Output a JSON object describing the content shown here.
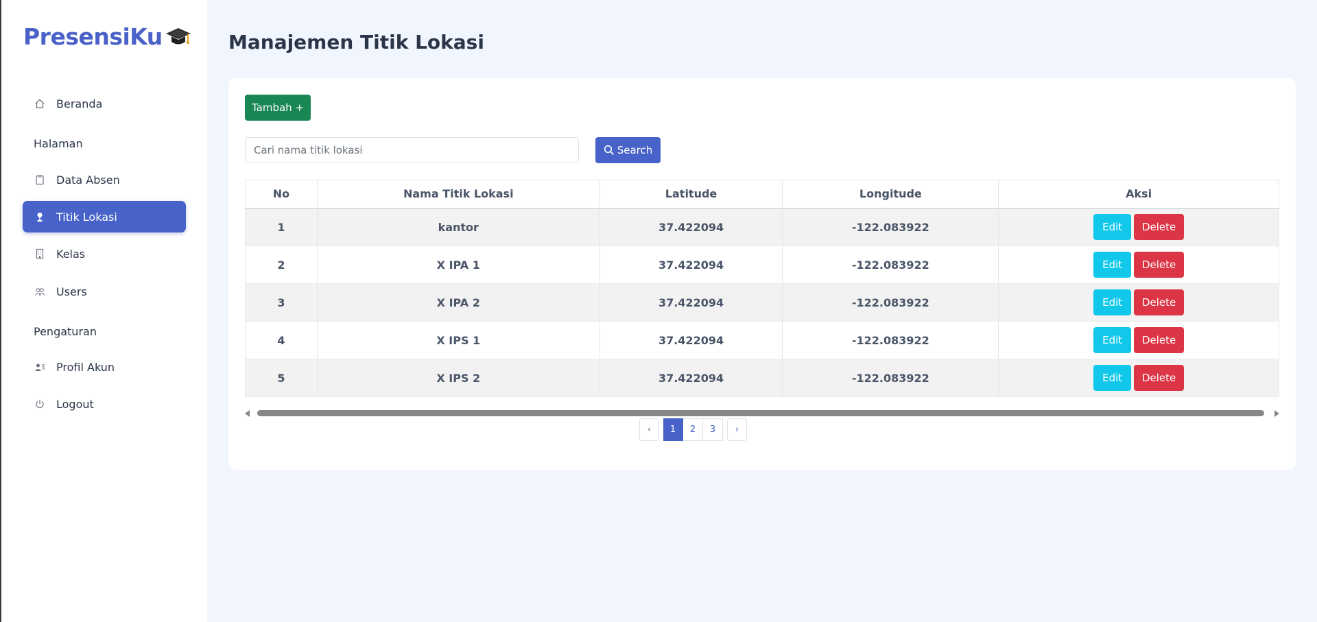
{
  "brand": {
    "name": "PresensiKu",
    "icon": "graduation-cap-icon"
  },
  "sidebar": {
    "items": [
      {
        "label": "Beranda",
        "icon": "home-icon"
      },
      {
        "label": "Data Absen",
        "icon": "clipboard-icon"
      },
      {
        "label": "Titik Lokasi",
        "icon": "map-pin-icon",
        "active": true
      },
      {
        "label": "Kelas",
        "icon": "building-icon"
      },
      {
        "label": "Users",
        "icon": "users-icon"
      },
      {
        "label": "Profil Akun",
        "icon": "user-card-icon"
      },
      {
        "label": "Logout",
        "icon": "power-icon"
      }
    ],
    "sections": [
      "Halaman",
      "Pengaturan"
    ]
  },
  "page": {
    "title": "Manajemen Titik Lokasi"
  },
  "toolbar": {
    "add_label": "Tambah +",
    "search_placeholder": "Cari nama titik lokasi",
    "search_label": "Search"
  },
  "table": {
    "headers": [
      "No",
      "Nama Titik Lokasi",
      "Latitude",
      "Longitude",
      "Aksi"
    ],
    "rows": [
      {
        "no": "1",
        "name": "kantor",
        "lat": "37.422094",
        "lng": "-122.083922"
      },
      {
        "no": "2",
        "name": "X IPA 1",
        "lat": "37.422094",
        "lng": "-122.083922"
      },
      {
        "no": "3",
        "name": "X IPA 2",
        "lat": "37.422094",
        "lng": "-122.083922"
      },
      {
        "no": "4",
        "name": "X IPS 1",
        "lat": "37.422094",
        "lng": "-122.083922"
      },
      {
        "no": "5",
        "name": "X IPS 2",
        "lat": "37.422094",
        "lng": "-122.083922"
      }
    ],
    "edit_label": "Edit",
    "delete_label": "Delete"
  },
  "pagination": {
    "prev": "‹",
    "pages": [
      "1",
      "2",
      "3"
    ],
    "current": "1",
    "next": "›"
  },
  "colors": {
    "primary": "#4763c9",
    "success": "#198754",
    "info": "#12c8ea",
    "danger": "#dc3545",
    "background": "#f1f5fd"
  }
}
